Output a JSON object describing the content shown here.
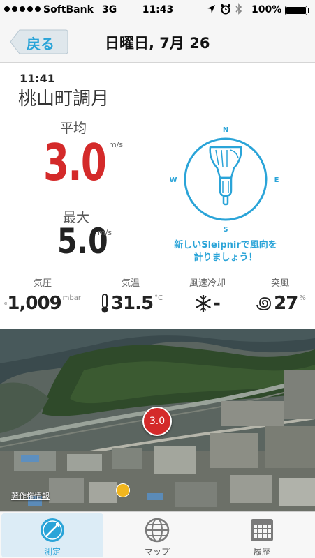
{
  "status_bar": {
    "carrier": "SoftBank",
    "network": "3G",
    "time": "11:43",
    "battery": "100%"
  },
  "nav": {
    "back_label": "戻る",
    "title": "日曜日, 7月 26"
  },
  "observation": {
    "time": "11:41",
    "location": "桃山町調月",
    "average_label": "平均",
    "average_value": "3.0",
    "average_unit": "m/s",
    "max_label": "最大",
    "max_value": "5.0",
    "max_unit": "m/s"
  },
  "compass": {
    "north": "N",
    "east": "E",
    "south": "S",
    "west": "W",
    "promo_line1": "新しいSleipnirで風向を",
    "promo_line2": "計りましょう！"
  },
  "metrics": [
    {
      "label": "気圧",
      "icon": "pressure-gauge-icon",
      "value": "1,009",
      "unit": "mbar"
    },
    {
      "label": "気温",
      "icon": "thermometer-icon",
      "value": "31.5",
      "unit": "°C"
    },
    {
      "label": "風速冷却",
      "icon": "snowflake-icon",
      "value": "-",
      "unit": ""
    },
    {
      "label": "突風",
      "icon": "gust-spiral-icon",
      "value": "27",
      "unit": "%"
    }
  ],
  "map": {
    "pin_value": "3.0",
    "attribution": "著作権情報"
  },
  "tabs": [
    {
      "label": "測定",
      "icon": "wind-gauge-icon",
      "active": true
    },
    {
      "label": "マップ",
      "icon": "globe-icon",
      "active": false
    },
    {
      "label": "履歴",
      "icon": "calendar-grid-icon",
      "active": false
    }
  ],
  "colors": {
    "accent": "#2aa4d8",
    "average": "#d42a2a"
  }
}
